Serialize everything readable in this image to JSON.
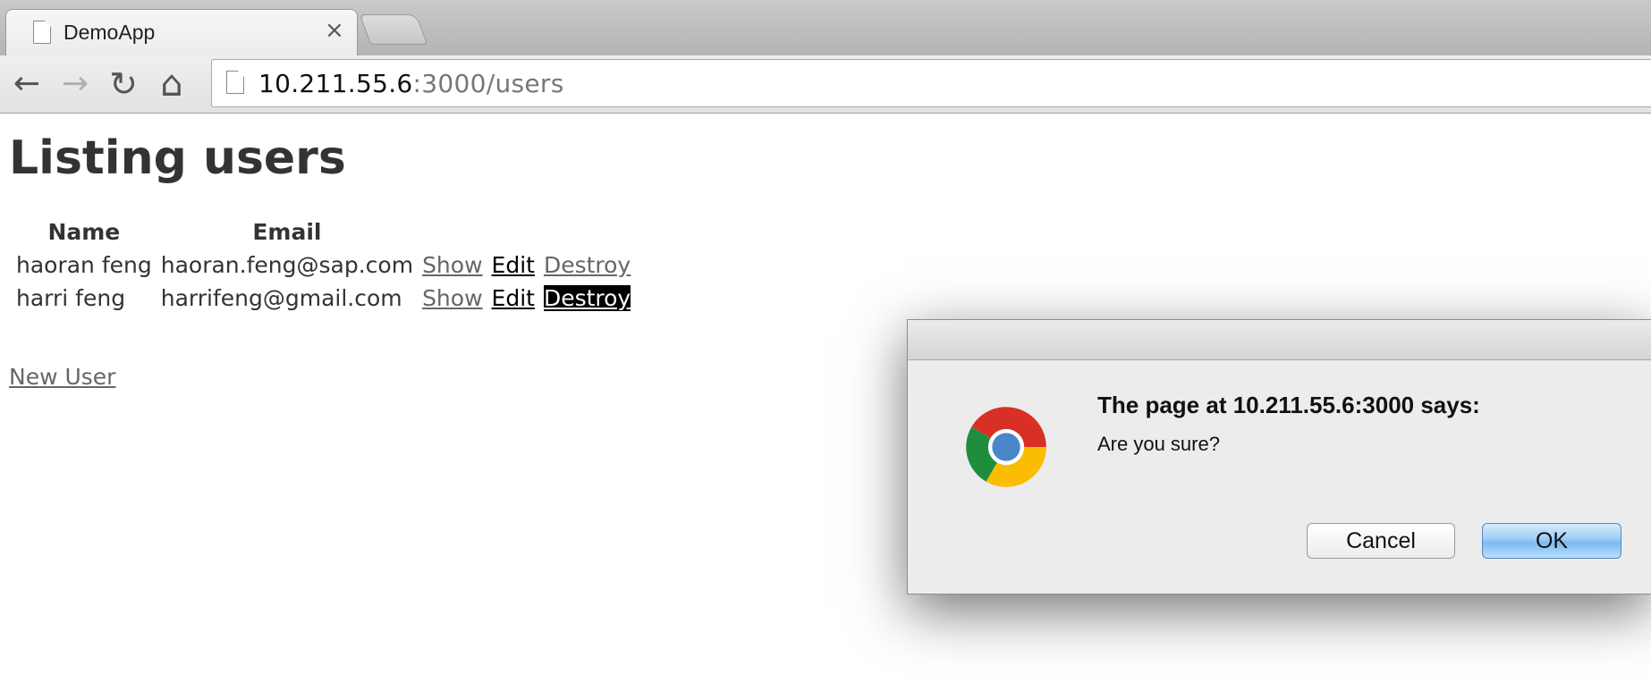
{
  "browser": {
    "tab_title": "DemoApp",
    "tab_close": "×",
    "url_host": "10.211.55.6",
    "url_rest": ":3000/users",
    "back": "←",
    "forward": "→",
    "reload": "↻",
    "home": "⌂"
  },
  "page": {
    "title": "Listing users",
    "columns": [
      "Name",
      "Email"
    ],
    "rows": [
      {
        "name": "haoran feng",
        "email": "haoran.feng@sap.com",
        "show": "Show",
        "edit": "Edit",
        "destroy": "Destroy"
      },
      {
        "name": "harri feng",
        "email": "harrifeng@gmail.com",
        "show": "Show",
        "edit": "Edit",
        "destroy": "Destroy"
      }
    ],
    "new_user": "New User"
  },
  "dialog": {
    "heading": "The page at 10.211.55.6:3000 says:",
    "message": "Are you sure?",
    "cancel": "Cancel",
    "ok": "OK"
  },
  "colors": {
    "link_gray": "#666666",
    "ok_button_blue": "#7bbaf0",
    "title_text": "#333333"
  },
  "icons": {
    "tab": "document-icon",
    "omnibox": "document-icon",
    "dialog": "chrome-logo-icon"
  }
}
